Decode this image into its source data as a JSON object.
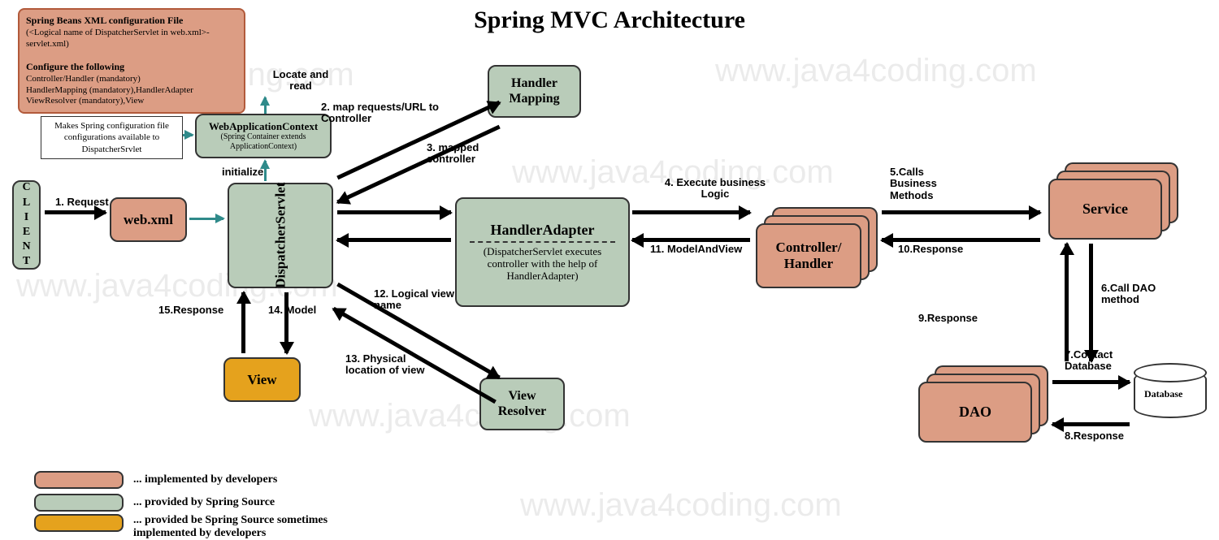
{
  "title": "Spring MVC Architecture",
  "watermark": "www.java4coding.com",
  "callout": {
    "heading1": "Spring Beans XML configuration File",
    "sub1": "(<Logical name of DispatcherServlet in web.xml>-servlet.xml)",
    "heading2": "Configure the following",
    "line1": "Controller/Handler (mandatory)",
    "line2": "HandlerMapping (mandatory),HandlerAdapter",
    "line3": "ViewResolver (mandatory),View"
  },
  "wacNote": "Makes Spring configuration file configurations available to DispatcherSrvlet",
  "labels": {
    "locateRead": "Locate and read",
    "initialize": "initialize",
    "l1": "1. Request",
    "l2": "2. map requests/URL to Controller",
    "l3": "3. mapped controller",
    "l4": "4. Execute business Logic",
    "l5": "5.Calls Business Methods",
    "l6": "6.Call DAO method",
    "l7": "7.Contact Database",
    "l8": "8.Response",
    "l9": "9.Response",
    "l10": "10.Response",
    "l11": "11. ModelAndView",
    "l12": "12. Logical view name",
    "l13": "13. Physical location of view",
    "l14": "14. Model",
    "l15": "15.Response"
  },
  "nodes": {
    "client": "C L I E N T",
    "webxml": "web.xml",
    "wac_title": "WebApplicationContext",
    "wac_sub": "(Spring Container extends ApplicationContext)",
    "dispatcher": "DispatcherServlet",
    "handlerMapping": "Handler Mapping",
    "handlerAdapter_title": "HandlerAdapter",
    "handlerAdapter_sub": "(DispatcherServlet executes controller with the help of HandlerAdapter)",
    "controller": "Controller/ Handler",
    "service": "Service",
    "dao": "DAO",
    "database": "Database",
    "view": "View",
    "viewResolver": "View Resolver"
  },
  "legend": {
    "dev": "... implemented by developers",
    "spring": "... provided by Spring Source",
    "mixed": "... provided be Spring Source sometimes implemented by developers"
  }
}
